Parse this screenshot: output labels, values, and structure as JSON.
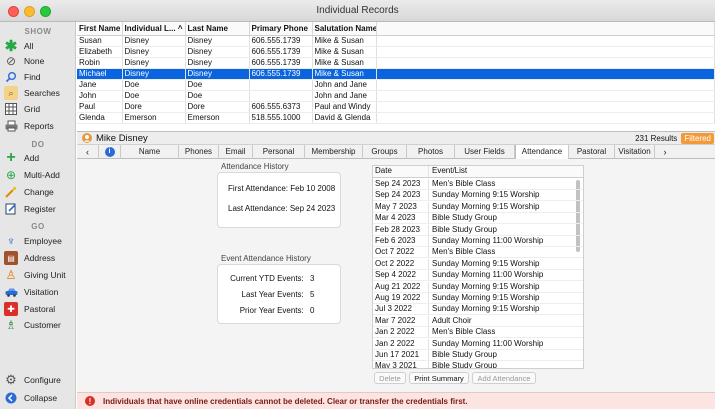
{
  "window": {
    "title": "Individual Records"
  },
  "sidebar": {
    "show_header": "SHOW",
    "do_header": "DO",
    "go_header": "GO",
    "show_items": [
      {
        "label": "All",
        "icon": "asterisk-icon"
      },
      {
        "label": "None",
        "icon": "none-icon"
      },
      {
        "label": "Find",
        "icon": "search-icon"
      },
      {
        "label": "Searches",
        "icon": "searches-icon"
      },
      {
        "label": "Grid",
        "icon": "grid-icon"
      },
      {
        "label": "Reports",
        "icon": "printer-icon"
      }
    ],
    "do_items": [
      {
        "label": "Add",
        "icon": "plus-icon"
      },
      {
        "label": "Multi-Add",
        "icon": "multi-add-icon"
      },
      {
        "label": "Change",
        "icon": "wand-icon"
      },
      {
        "label": "Register",
        "icon": "register-icon"
      }
    ],
    "go_items": [
      {
        "label": "Employee",
        "icon": "employee-icon"
      },
      {
        "label": "Address",
        "icon": "address-icon"
      },
      {
        "label": "Giving Unit",
        "icon": "giving-unit-icon"
      },
      {
        "label": "Visitation",
        "icon": "car-icon"
      },
      {
        "label": "Pastoral",
        "icon": "pastoral-icon"
      },
      {
        "label": "Customer",
        "icon": "customer-icon"
      }
    ],
    "configure": "Configure",
    "collapse": "Collapse"
  },
  "grid": {
    "columns": [
      "First Name",
      "Individual L... ^",
      "Last Name",
      "Primary Phone",
      "Salutation Name"
    ],
    "rows": [
      [
        "Susan",
        "Disney",
        "Disney",
        "606.555.1739",
        "Mike & Susan"
      ],
      [
        "Elizabeth",
        "Disney",
        "Disney",
        "606.555.1739",
        "Mike & Susan"
      ],
      [
        "Robin",
        "Disney",
        "Disney",
        "606.555.1739",
        "Mike & Susan"
      ],
      [
        "Michael",
        "Disney",
        "Disney",
        "606.555.1739",
        "Mike & Susan"
      ],
      [
        "Jane",
        "Doe",
        "Doe",
        "",
        "John and Jane"
      ],
      [
        "John",
        "Doe",
        "Doe",
        "",
        "John and Jane"
      ],
      [
        "Paul",
        "Dore",
        "Dore",
        "606.555.6373",
        "Paul and Windy"
      ],
      [
        "Glenda",
        "Emerson",
        "Emerson",
        "518.555.1000",
        "David & Glenda"
      ]
    ]
  },
  "detail": {
    "name": "Mike Disney",
    "results": "231 Results",
    "filtered": "Filtered"
  },
  "tabs": [
    "Name",
    "Phones",
    "Email",
    "Personal",
    "Membership",
    "Groups",
    "Photos",
    "User Fields",
    "Attendance",
    "Pastoral",
    "Visitation"
  ],
  "attendance": {
    "history_title": "Attendance History",
    "first_attendance_label": "First Attendance:",
    "first_attendance_value": "Feb 10 2008",
    "last_attendance_label": "Last Attendance:",
    "last_attendance_value": "Sep 24 2023",
    "event_history_title": "Event Attendance History",
    "ytd_label": "Current YTD Events:",
    "ytd_value": "3",
    "last_year_label": "Last Year Events:",
    "last_year_value": "5",
    "prior_year_label": "Prior Year Events:",
    "prior_year_value": "0"
  },
  "events_table": {
    "columns": [
      "Date",
      "Event/List"
    ],
    "rows": [
      [
        "Sep 24 2023",
        "Men's Bible Class"
      ],
      [
        "Sep 24 2023",
        "Sunday Morning 9:15 Worship"
      ],
      [
        "May 7 2023",
        "Sunday Morning 9:15 Worship"
      ],
      [
        "Mar 4 2023",
        "Bible Study Group"
      ],
      [
        "Feb 28 2023",
        "Bible Study Group"
      ],
      [
        "Feb 6 2023",
        "Sunday Morning 11:00 Worship"
      ],
      [
        "Oct 7 2022",
        "Men's Bible Class"
      ],
      [
        "Oct 2 2022",
        "Sunday Morning 9:15 Worship"
      ],
      [
        "Sep 4 2022",
        "Sunday Morning 11:00 Worship"
      ],
      [
        "Aug 21 2022",
        "Sunday Morning 9:15 Worship"
      ],
      [
        "Aug 19 2022",
        "Sunday Morning 9:15 Worship"
      ],
      [
        "Jul 3 2022",
        "Sunday Morning 9:15 Worship"
      ],
      [
        "Mar 7 2022",
        "Adult Choir"
      ],
      [
        "Jan 2 2022",
        "Men's Bible Class"
      ],
      [
        "Jan 2 2022",
        "Sunday Morning 11:00 Worship"
      ],
      [
        "Jun 17 2021",
        "Bible Study Group"
      ],
      [
        "May 3 2021",
        "Bible Study Group"
      ]
    ]
  },
  "buttons": {
    "delete": "Delete",
    "print_summary": "Print Summary",
    "add_attendance": "Add Attendance"
  },
  "footer": {
    "message": "Individuals that have online credentials cannot be deleted. Clear or transfer the credentials first."
  },
  "colors": {
    "selection": "#0a64e0",
    "filtered": "#f39a38",
    "error": "#d93025",
    "accent_green": "#27a745"
  }
}
